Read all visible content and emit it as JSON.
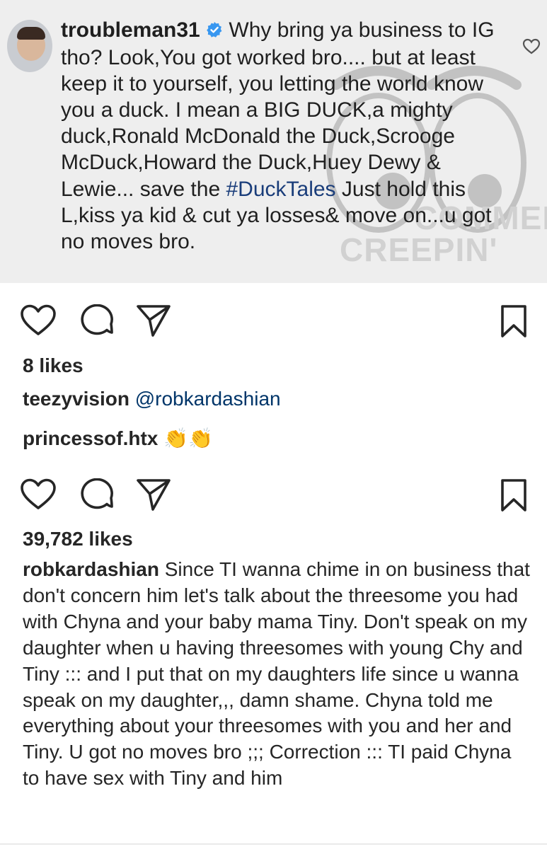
{
  "comment": {
    "username": "troubleman31",
    "text_before_hashtag": "Why bring ya business to IG tho? Look,You got worked bro.... but at least keep it to yourself, you letting the world know you a duck. I mean a BIG DUCK,a mighty duck,Ronald McDonald the Duck,Scrooge McDuck,Howard the Duck,Huey Dewy & Lewie... save the",
    "hashtag": "#DuckTales",
    "text_after_hashtag": "Just hold this L,kiss ya kid & cut ya losses& move on...u got no moves bro.",
    "watermark_line1": "COMMENT",
    "watermark_line2": "CREEPIN'"
  },
  "post1": {
    "likes": "8 likes",
    "comments": [
      {
        "username": "teezyvision",
        "mention": "@robkardashian"
      },
      {
        "username": "princessof.htx",
        "emoji": "👏👏"
      }
    ]
  },
  "post2": {
    "likes": "39,782 likes",
    "caption_username": "robkardashian",
    "caption_text": "Since TI wanna chime in on business that don't concern him let's talk about the threesome you had with Chyna and your baby mama Tiny. Don't speak on my daughter when u having threesomes with young Chy and Tiny ::: and I put that on my daughters life since u wanna speak on my daughter,,, damn shame. Chyna told me everything about your threesomes with you and her and Tiny.  U got no moves bro ;;; Correction ::: TI paid Chyna to have sex with Tiny and him"
  },
  "icons": [
    "heart-icon",
    "comment-icon",
    "share-icon",
    "bookmark-icon",
    "verified-badge-icon",
    "clapping-hands-icon"
  ],
  "colors": {
    "verified": "#3897f0",
    "hashtag": "#1a3d7a",
    "mention": "#003569",
    "panel_bg": "#eeeeee",
    "text": "#262626"
  }
}
